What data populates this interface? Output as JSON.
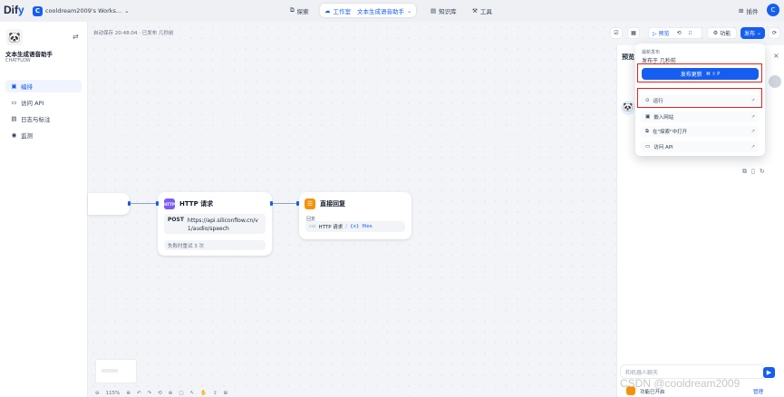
{
  "header": {
    "logo_text": "Dif",
    "logo_accent": "y",
    "workspace_badge": "C",
    "workspace_name": "cooldream2009's Works...",
    "nav": [
      {
        "label": "探索",
        "icon": "compass-icon"
      },
      {
        "label": "工作室",
        "icon": "studio-icon",
        "sub": "文本生成语音助手"
      },
      {
        "label": "知识库",
        "icon": "book-icon"
      },
      {
        "label": "工具",
        "icon": "tool-icon"
      }
    ],
    "plugin_label": "插件",
    "user_initial": "C"
  },
  "sidebar": {
    "app_name": "文本生成语音助手",
    "app_mode": "CHATFLOW",
    "items": [
      {
        "label": "编排",
        "icon": "layout-icon"
      },
      {
        "label": "访问 API",
        "icon": "terminal-icon"
      },
      {
        "label": "日志与标注",
        "icon": "file-icon"
      },
      {
        "label": "监测",
        "icon": "monitor-icon"
      }
    ]
  },
  "canvas": {
    "autosave": "自动保存 20:48:04 · 已发布 几秒前",
    "http_node": {
      "title": "HTTP 请求",
      "icon_text": "HTTP",
      "method": "POST",
      "url": "https://api.siliconflow.cn/v1/audio/speech",
      "retry": "失败时重试 3 次"
    },
    "answer_node": {
      "title": "直接回复",
      "label": "回复",
      "var_source": "HTTP 请求",
      "var_name": "files"
    },
    "zoom": "115%"
  },
  "toolbar": {
    "preview": "预览",
    "features": "功能",
    "publish": "发布"
  },
  "panel": {
    "title": "预览",
    "chat_placeholder": "和机器人聊天",
    "footer_left": "功能已开启",
    "footer_right": "管理"
  },
  "publish_popup": {
    "latest_label": "最新发布",
    "published_time": "发布于 几秒前",
    "update_button": "发布更新",
    "shortcut": "⌘ ⇧ P",
    "items": [
      {
        "label": "运行",
        "icon": "play-icon"
      },
      {
        "label": "嵌入网站",
        "icon": "embed-icon"
      },
      {
        "label": "在\"探索\"中打开",
        "icon": "external-icon"
      },
      {
        "label": "访问 API",
        "icon": "terminal-icon"
      }
    ]
  },
  "watermark": "CSDN @cooldream2009",
  "colors": {
    "accent": "#155eef",
    "highlight": "#e02020"
  }
}
